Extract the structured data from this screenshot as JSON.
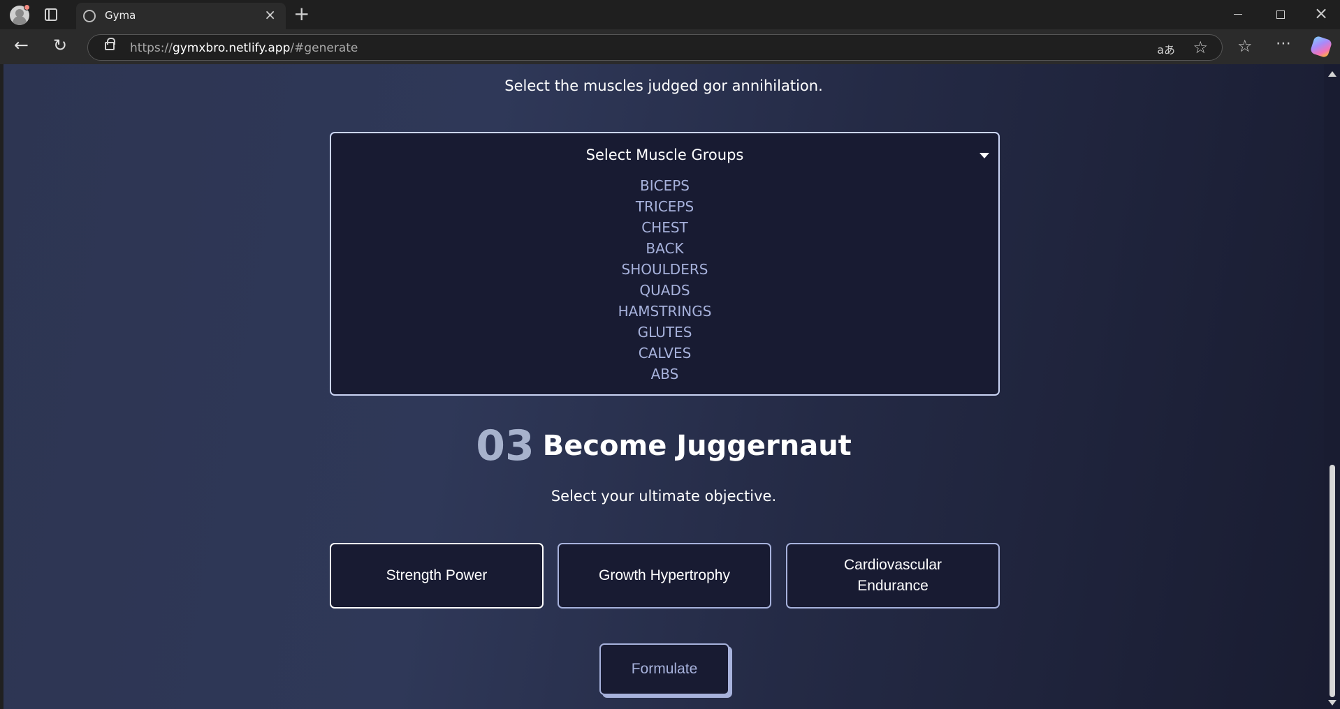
{
  "browser": {
    "tab_title": "Gyma",
    "url_prefix": "https://",
    "url_host": "gymxbro.netlify.app",
    "url_hash": "/#generate",
    "read_aloud": "aあ"
  },
  "page": {
    "muscles_prompt": "Select the muscles judged gor annihilation.",
    "muscle_dropdown": {
      "label": "Select Muscle Groups",
      "options": [
        "BICEPS",
        "TRICEPS",
        "CHEST",
        "BACK",
        "SHOULDERS",
        "QUADS",
        "HAMSTRINGS",
        "GLUTES",
        "CALVES",
        "ABS"
      ]
    },
    "step": {
      "number": "03",
      "title": "Become Juggernaut"
    },
    "objective_prompt": "Select your ultimate objective.",
    "goals": [
      {
        "label": "Strength Power"
      },
      {
        "label": "Growth Hypertrophy"
      },
      {
        "label": "Cardiovascular Endurance"
      }
    ],
    "submit_label": "Formulate"
  }
}
